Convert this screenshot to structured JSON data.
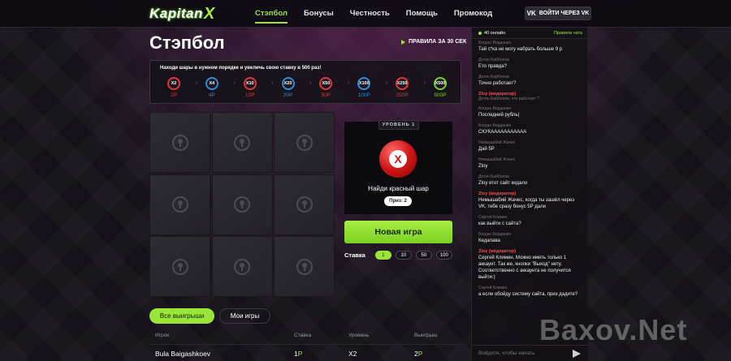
{
  "header": {
    "logo": {
      "main": "Kapitan",
      "accent": "X"
    },
    "nav": [
      "Стэпбол",
      "Бонусы",
      "Честность",
      "Помощь",
      "Промокод"
    ],
    "vk_login": "ВОЙТИ ЧЕРЕЗ VK",
    "vk_icon": "VK"
  },
  "page": {
    "title": "Стэпбол",
    "rules_link": "ПРАВИЛА ЗА 30 СЕК"
  },
  "info": {
    "hint": "Находи шары в нужном порядке и увеличь свою ставку в 500 раз!",
    "steps": [
      {
        "multiplier": "X2",
        "value": "2Р",
        "color": "#e0363b"
      },
      {
        "multiplier": "X4",
        "value": "4Р",
        "color": "#2e8bd6"
      },
      {
        "multiplier": "X10",
        "value": "10Р",
        "color": "#e0363b"
      },
      {
        "multiplier": "X20",
        "value": "20Р",
        "color": "#2e8bd6"
      },
      {
        "multiplier": "X50",
        "value": "50Р",
        "color": "#e0363b"
      },
      {
        "multiplier": "X100",
        "value": "100Р",
        "color": "#2e8bd6"
      },
      {
        "multiplier": "X250",
        "value": "250Р",
        "color": "#e0363b"
      },
      {
        "multiplier": "X500",
        "value": "500Р",
        "color": "#7cd021"
      }
    ]
  },
  "game": {
    "level": "УРОВЕНЬ 1",
    "ball_mark": "X",
    "find_text": "Найди красный шар",
    "prize": "Приз: 2",
    "new_game": "Новая игра",
    "bet_label": "Ставка",
    "bet_options": [
      "1",
      "10",
      "50",
      "100"
    ]
  },
  "tabs": {
    "all": "Все выигрыши",
    "mine": "Мои игры"
  },
  "table": {
    "headers": [
      "Игрок",
      "Ставка",
      "Уровень",
      "Выигрыш"
    ],
    "row": {
      "player": "Bula Baigashkoev",
      "bet": "1",
      "bet_currency": "Р",
      "level": "X2",
      "win": "2",
      "win_currency": "Р"
    }
  },
  "chat": {
    "online": "40 онлайн",
    "rules": "Правила чата",
    "messages": [
      {
        "author": "Богдан Верданич",
        "text": "Тай с*ка не могу набрать больше 9 р"
      },
      {
        "author": "Детян Байболов",
        "text": "Ето правда?"
      },
      {
        "author": "Детян Байболов",
        "text": "Точно работает?"
      },
      {
        "author": "Zloy (модератор)",
        "mod": true,
        "quote": "Детян Байболов, что работает ?"
      },
      {
        "author": "Богдан Верданич",
        "text": "Последний рубль("
      },
      {
        "author": "Богдан Верданич",
        "text": "СКУКААААААААААА"
      },
      {
        "author": "Немышабий Жачес",
        "text": "Дай 5Р"
      },
      {
        "author": "Немышабий Жачес",
        "text": "Zloy"
      },
      {
        "author": "Детян Байболов",
        "text": "Zloy етот сайт кидало"
      },
      {
        "author": "Zloy (модератор)",
        "mod": true,
        "text": "Немышабий Жачес, когда ты зашёл через VK, тебе сразу бонус 5Р дали"
      },
      {
        "author": "Сергей Климин",
        "text": "как выйти с сайта?"
      },
      {
        "author": "Богдан Верданич",
        "text": "Кедалава"
      },
      {
        "author": "Zloy (модератор)",
        "mod": true,
        "text": "Сергей Климин, Можно иметь только 1 аккаунт. Так же, кнопки \"Выход\" нету. Соответственно с аккаунта не получится выйти:)"
      },
      {
        "author": "Сергей Климин",
        "text": "а если обойду систему сайта, приз дадите?"
      }
    ],
    "input_placeholder": "Войдите, чтобы начать"
  },
  "watermark": "Baxov.Net"
}
